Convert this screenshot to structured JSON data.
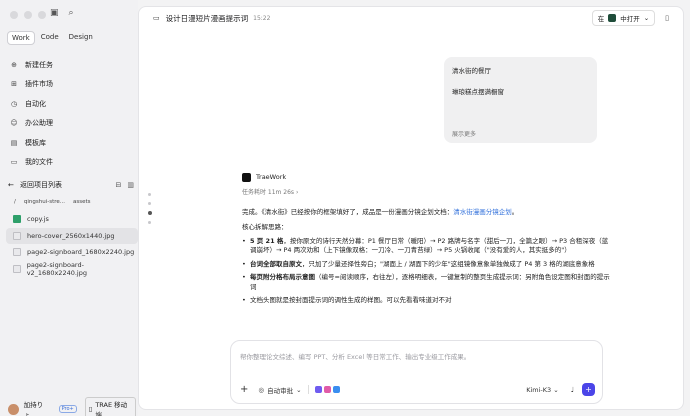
{
  "sidebar": {
    "mode_tabs": [
      "Work",
      "Code",
      "Design"
    ],
    "nav_items": [
      {
        "label": "新建任务",
        "icon": "new-task-icon"
      },
      {
        "label": "插件市场",
        "icon": "plugin-icon"
      },
      {
        "label": "自动化",
        "icon": "automation-icon"
      },
      {
        "label": "办公助理",
        "icon": "assistant-icon"
      },
      {
        "label": "模板库",
        "icon": "template-icon"
      },
      {
        "label": "我的文件",
        "icon": "folder-icon"
      }
    ],
    "project_back_label": "返回项目列表",
    "breadcrumb": [
      "/",
      "qingshui-stre...",
      "assets"
    ],
    "files": [
      {
        "name": "copy.js",
        "type": "js",
        "selected": false
      },
      {
        "name": "hero-cover_2560x1440.jpg",
        "type": "img",
        "selected": true
      },
      {
        "name": "page2-signboard_1680x2240.jpg",
        "type": "img",
        "selected": false
      },
      {
        "name": "page2-signboard-v2_1680x2240.jpg",
        "type": "img",
        "selected": false
      }
    ],
    "user_name": "加持りょ...",
    "user_badge": "Pro+",
    "mobile_label": "TRAE 移动端"
  },
  "header": {
    "title": "设计日漫短片漫画提示词",
    "time": "15:22",
    "open_in_prefix": "在",
    "open_in_label": "中打开"
  },
  "user_message": {
    "line1": "清水街的餐厅",
    "line2": "琳琅糕点摆满橱窗",
    "show_more": "展示更多"
  },
  "answer": {
    "brand": "TraeWork",
    "elapsed": "任务耗时 11m 26s",
    "intro_before_link": "完成。《清水街》已经按你的框架填好了，成品是一份漫画分镜企划文档：",
    "intro_link": "清水街漫画分镜企划",
    "intro_after_link": "。",
    "section_title": "核心拆解思路：",
    "bullets": [
      {
        "bold": "5 页 21 格",
        "text": "，按你原文的诗行天然分幕：P1 餐厅日常（暖阳）→ P2 路牌与名字（甜后一刀，全篇之眼）→ P3 合租深夜（蓝调崩坏）→ P4 两次劝和（上下镜像双格：一刀冷、一刀青苔绿）→ P5 火锅收尾（\"没有爱的人，其实挺多的\"）"
      },
      {
        "bold": "台词全部取自原文",
        "text": "，只加了少量还择性旁白；\"湖面上 / 湖面下的少年\"这组镜像意象单独做成了 P4 第 3 格的湖底意象格"
      },
      {
        "bold": "每页附分格布局示意图",
        "text": "（编号=阅读顺序，右往左），逐格明细表，一键复制的整页生成提示词：另附角色设定图和封面的提示词"
      },
      {
        "bold": "",
        "text": "文档头图就是按封面提示词的调性生成的样图。可以先看看味道对不对"
      }
    ]
  },
  "composer": {
    "placeholder": "帮你整理论文综述、编写 PPT、分析 Excel 等日常工作、输出专业级工作成果。",
    "auto_label": "自动审批",
    "model": "Kimi-K3"
  },
  "colors": {
    "accent": "#4b45e8",
    "link": "#2f6fdb"
  }
}
